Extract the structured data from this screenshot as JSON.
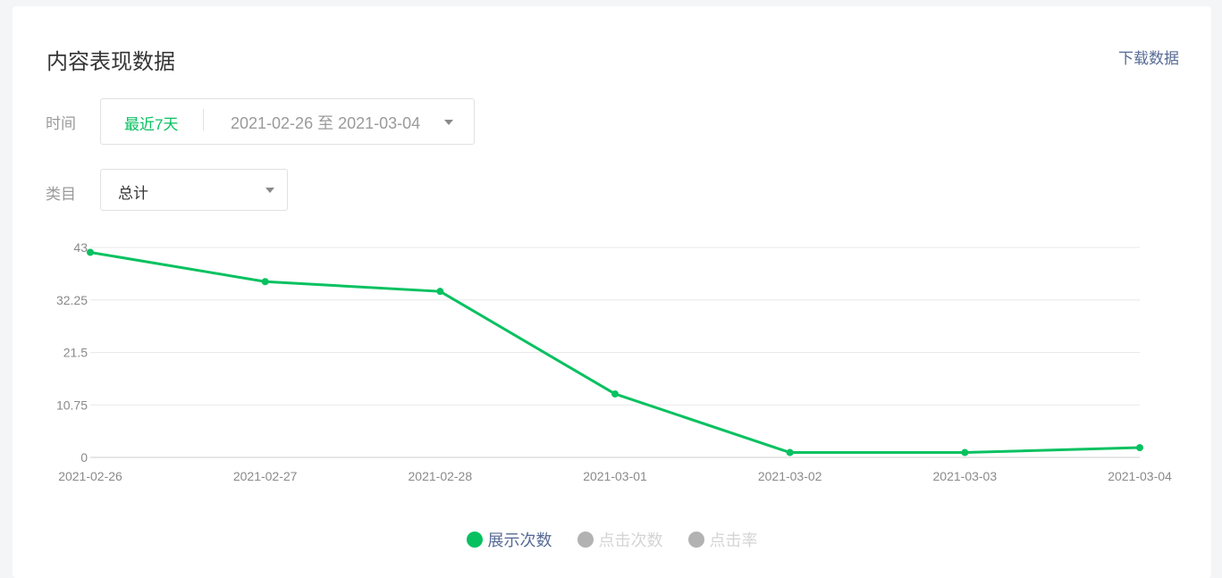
{
  "card": {
    "title": "内容表现数据",
    "download_label": "下载数据"
  },
  "filters": {
    "time_label": "时间",
    "recent_label": "最近7天",
    "date_range": "2021-02-26 至 2021-03-04",
    "category_label": "类目",
    "category_value": "总计"
  },
  "legend": [
    {
      "label": "展示次数",
      "active": true
    },
    {
      "label": "点击次数",
      "active": false
    },
    {
      "label": "点击率",
      "active": false
    }
  ],
  "colors": {
    "accent": "#07c160",
    "link": "#576b95",
    "inactive_dot": "#b2b2b2",
    "inactive_text": "#d4d4d4"
  },
  "chart_data": {
    "type": "line",
    "categories": [
      "2021-02-26",
      "2021-02-27",
      "2021-02-28",
      "2021-03-01",
      "2021-03-02",
      "2021-03-03",
      "2021-03-04"
    ],
    "series": [
      {
        "name": "展示次数",
        "values": [
          42,
          36,
          34,
          13,
          1,
          1,
          2
        ]
      }
    ],
    "yticks": [
      "0",
      "10.75",
      "21.5",
      "32.25",
      "43"
    ],
    "ylim": [
      0,
      43
    ],
    "grid": true,
    "legend_position": "bottom-center"
  }
}
